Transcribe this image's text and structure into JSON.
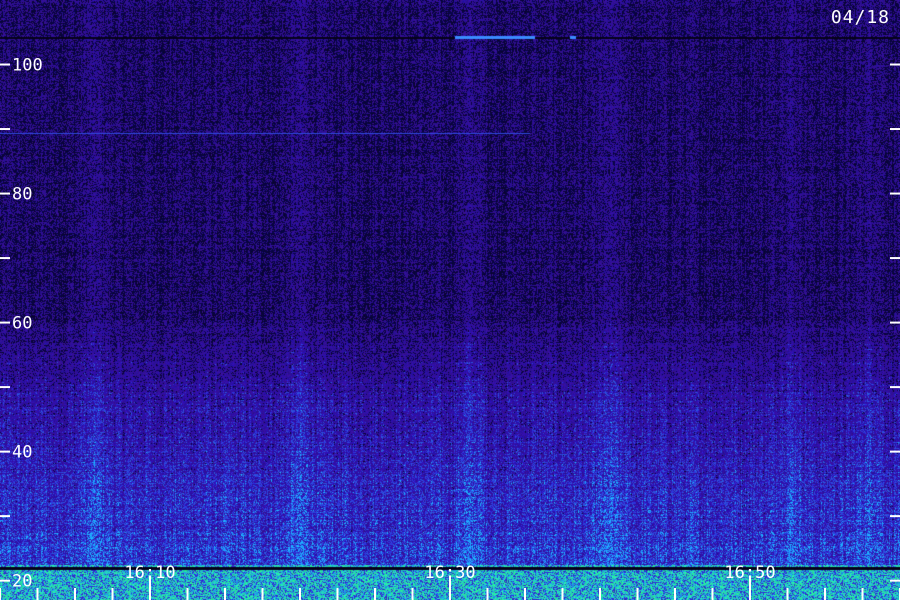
{
  "chart_data": {
    "type": "heatmap",
    "title": "",
    "xlabel": "",
    "ylabel": "",
    "date_label": "04/18",
    "y_axis": {
      "range": [
        17,
        110
      ],
      "labeled_ticks": [
        "20",
        "40",
        "60",
        "80",
        "100"
      ],
      "labeled_values": [
        20,
        40,
        60,
        80,
        100
      ],
      "minor_values": [
        30,
        50,
        70,
        90
      ]
    },
    "x_axis": {
      "range_minutes": [
        0,
        60
      ],
      "labeled_ticks": [
        "16:10",
        "16:30",
        "16:50"
      ],
      "labeled_minutes": [
        10,
        30,
        50
      ],
      "minor_minutes": [
        0,
        2.5,
        5,
        7.5,
        12.5,
        15,
        17.5,
        20,
        22.5,
        25,
        27.5,
        32.5,
        35,
        37.5,
        40,
        42.5,
        45,
        47.5,
        52.5,
        55,
        57.5,
        60
      ]
    },
    "colors": {
      "background": "#1a0a5a",
      "low": "#0a0530",
      "mid": "#3a20d0",
      "high": "#2a8cff",
      "peak": "#38e890",
      "ticks": "#ffffff"
    },
    "bands": [
      {
        "from": 17,
        "to": 22,
        "intensity": 0.95
      },
      {
        "from": 22,
        "to": 60,
        "intensity": 0.45
      },
      {
        "from": 60,
        "to": 110,
        "intensity": 0.15
      }
    ]
  }
}
